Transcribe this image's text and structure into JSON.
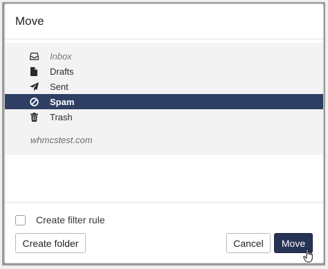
{
  "dialog": {
    "title": "Move",
    "account": "whmcstest.com",
    "folders": [
      {
        "label": "Inbox",
        "icon": "inbox-icon",
        "state": "muted"
      },
      {
        "label": "Drafts",
        "icon": "file-icon",
        "state": "normal"
      },
      {
        "label": "Sent",
        "icon": "paper-plane-icon",
        "state": "normal"
      },
      {
        "label": "Spam",
        "icon": "ban-icon",
        "state": "selected"
      },
      {
        "label": "Trash",
        "icon": "trash-icon",
        "state": "normal"
      }
    ],
    "filter_rule_label": "Create filter rule",
    "filter_rule_checked": false,
    "buttons": {
      "create_folder": "Create folder",
      "cancel": "Cancel",
      "move": "Move"
    }
  },
  "colors": {
    "selected_bg": "#2f3e63",
    "primary_button": "#263354",
    "panel_bg": "#f3f3f3"
  }
}
